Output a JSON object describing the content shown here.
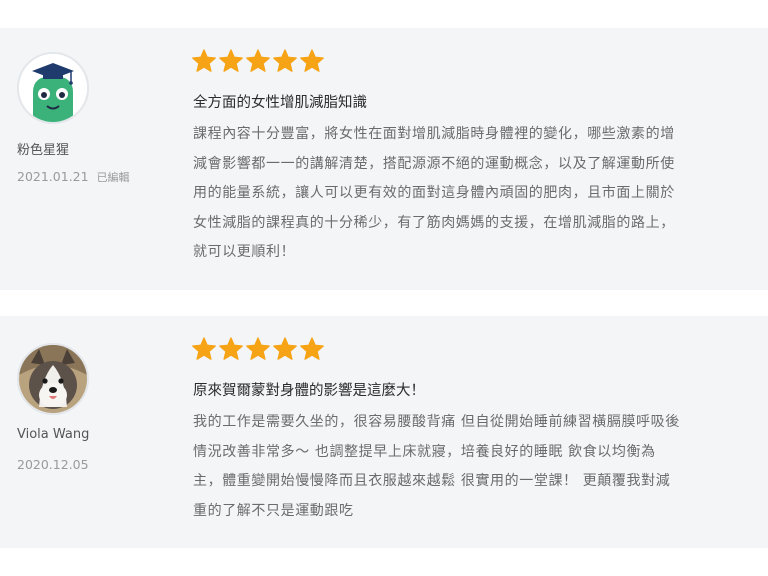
{
  "colors": {
    "card_background": "#f3f5f7",
    "star": "#f6a316",
    "title_text": "#2b2b2b",
    "body_text": "#6b6b6b",
    "meta_text": "#9a9a9a"
  },
  "reviews": [
    {
      "avatar": "green-mascot-with-graduation-cap",
      "author": "粉色星猩",
      "date": "2021.01.21",
      "edited_label": "已編輯",
      "rating": 5,
      "title": "全方面的女性增肌減脂知識",
      "body_lines": [
        "課程內容十分豐富，將女性在面對增肌減脂時身體裡的變化，哪些激素的增",
        "減會影響都一一的講解清楚，搭配源源不絕的運動概念，以及了解運動所使",
        "用的能量系統，讓人可以更有效的面對這身體內頑固的肥肉，且市面上關於",
        "女性減脂的課程真的十分稀少，有了筋肉媽媽的支援，在增肌減脂的路上，",
        "就可以更順利！"
      ]
    },
    {
      "avatar": "husky-dog-photo",
      "author": "Viola Wang",
      "date": "2020.12.05",
      "rating": 5,
      "title": "原來賀爾蒙對身體的影響是這麼大！",
      "body_lines": [
        "我的工作是需要久坐的，很容易腰酸背痛 但自從開始睡前練習橫膈膜呼吸後",
        "情況改善非常多～ 也調整提早上床就寢，培養良好的睡眠 飲食以均衡為",
        "主，體重變開始慢慢降而且衣服越來越鬆 很實用的一堂課！ 更顛覆我對減",
        "重的了解不只是運動跟吃"
      ]
    }
  ]
}
